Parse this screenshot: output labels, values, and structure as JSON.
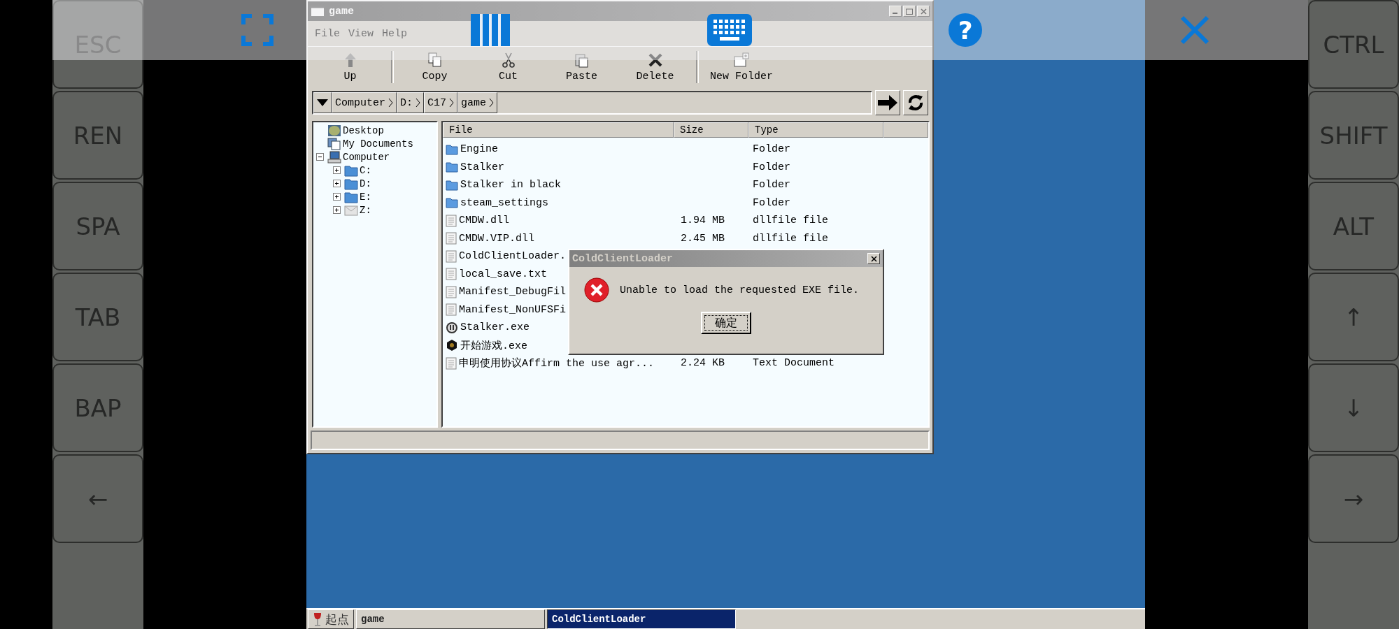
{
  "overlay": {
    "buttons": [
      {
        "kind": "fullscreen"
      },
      {
        "kind": "columns"
      },
      {
        "kind": "keyboard"
      },
      {
        "kind": "help",
        "label": "?"
      },
      {
        "kind": "close"
      }
    ]
  },
  "keys_left": [
    "ESC",
    "REN",
    "SPA",
    "TAB",
    "BAP",
    "←"
  ],
  "keys_right": [
    "CTRL",
    "SHIFT",
    "ALT",
    "↑",
    "↓",
    "→"
  ],
  "window": {
    "title": "game",
    "menu": [
      "File",
      "View",
      "Help"
    ],
    "toolbar": [
      {
        "label": "Up",
        "kind": "up"
      },
      {
        "label": "Copy",
        "kind": "copy"
      },
      {
        "label": "Cut",
        "kind": "cut"
      },
      {
        "label": "Paste",
        "kind": "paste"
      },
      {
        "label": "Delete",
        "kind": "delete"
      },
      {
        "label": "New Folder",
        "kind": "new_folder"
      }
    ],
    "address": {
      "crumbs": [
        "Computer",
        "D:",
        "C17",
        "game"
      ]
    },
    "tree": [
      {
        "label": "Desktop",
        "kind": "desktop"
      },
      {
        "label": "My Documents",
        "kind": "documents"
      },
      {
        "label": "Computer",
        "kind": "computer",
        "expanded": true,
        "children": [
          {
            "label": "C:",
            "kind": "drive",
            "expanded": false
          },
          {
            "label": "D:",
            "kind": "drive",
            "expanded": false
          },
          {
            "label": "E:",
            "kind": "drive",
            "expanded": false
          },
          {
            "label": "Z:",
            "kind": "mapped_drive",
            "expanded": false
          }
        ]
      }
    ],
    "files": {
      "columns": [
        "File",
        "Size",
        "Type"
      ],
      "rows": [
        {
          "name": "Engine",
          "type": "Folder",
          "kind": "folder"
        },
        {
          "name": "Stalker",
          "type": "Folder",
          "kind": "folder"
        },
        {
          "name": "Stalker in black",
          "type": "Folder",
          "kind": "folder"
        },
        {
          "name": "steam_settings",
          "type": "Folder",
          "kind": "folder"
        },
        {
          "name": "CMDW.dll",
          "size": "1.94 MB",
          "type": "dllfile file",
          "kind": "file"
        },
        {
          "name": "CMDW.VIP.dll",
          "size": "2.45 MB",
          "type": "dllfile file",
          "kind": "file"
        },
        {
          "name": "ColdClientLoader.",
          "kind": "file"
        },
        {
          "name": "local_save.txt",
          "kind": "file"
        },
        {
          "name": "Manifest_DebugFil",
          "kind": "file"
        },
        {
          "name": "Manifest_NonUFSFi",
          "kind": "file"
        },
        {
          "name": "Stalker.exe",
          "kind": "engine_exe"
        },
        {
          "name": "开始游戏.exe",
          "kind": "game_exe"
        },
        {
          "name": "申明使用协议Affirm the use agr...",
          "size": "2.24 KB",
          "type": "Text Document",
          "kind": "file"
        }
      ]
    }
  },
  "dialog": {
    "title": "ColdClientLoader",
    "message": "Unable to load the requested EXE file.",
    "button": "确定"
  },
  "taskbar": {
    "start": "起点",
    "tasks": [
      {
        "label": "game",
        "selected": false
      },
      {
        "label": "ColdClientLoader",
        "selected": true
      }
    ]
  }
}
